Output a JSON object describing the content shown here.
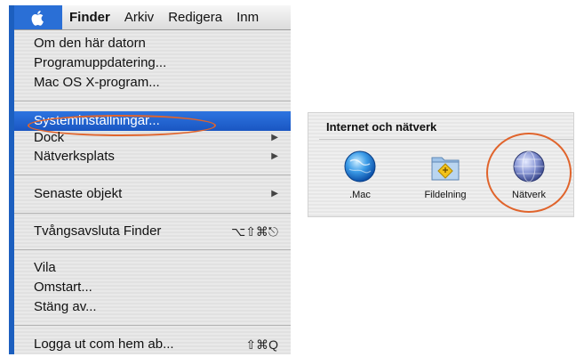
{
  "menubar": {
    "items": [
      "Finder",
      "Arkiv",
      "Redigera",
      "Inm"
    ]
  },
  "apple_menu": {
    "items": [
      {
        "label": "Om den här datorn"
      },
      {
        "label": "Programuppdatering..."
      },
      {
        "label": "Mac OS X-program..."
      },
      {
        "label": "Systeminställningar..."
      },
      {
        "label": "Dock"
      },
      {
        "label": "Nätverksplats"
      },
      {
        "label": "Senaste objekt"
      },
      {
        "label": "Tvångsavsluta Finder",
        "shortcut": "⌥⇧⌘⎋"
      },
      {
        "label": "Vila"
      },
      {
        "label": "Omstart..."
      },
      {
        "label": "Stäng av..."
      },
      {
        "label": "Logga ut com hem ab...",
        "shortcut": "⇧⌘Q"
      }
    ],
    "selected": "Systeminställningar..."
  },
  "preferences": {
    "section_title": "Internet och nätverk",
    "items": [
      {
        "label": ".Mac",
        "icon": "dotmac-globe-icon"
      },
      {
        "label": "Fildelning",
        "icon": "file-sharing-folder-icon"
      },
      {
        "label": "Nätverk",
        "icon": "network-globe-icon"
      }
    ],
    "highlighted": "Nätverk"
  },
  "colors": {
    "selection": "#1a56c2",
    "annotation_circle": "#e0642c",
    "apple_tab": "#2a6fd6"
  }
}
